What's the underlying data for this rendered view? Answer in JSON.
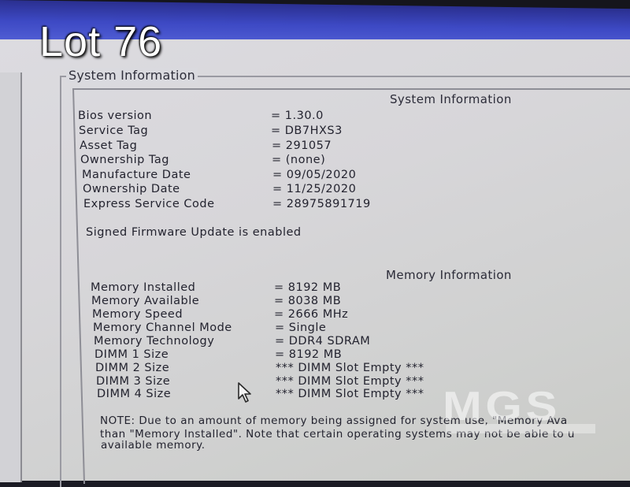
{
  "overlay": {
    "lot_label": "Lot 76",
    "watermark": "MGS"
  },
  "group": {
    "legend": "System Information"
  },
  "system": {
    "title": "System Information",
    "rows": [
      {
        "label": "Bios version",
        "value": "= 1.30.0"
      },
      {
        "label": "Service Tag",
        "value": "= DB7HXS3"
      },
      {
        "label": "Asset Tag",
        "value": "= 291057"
      },
      {
        "label": "Ownership Tag",
        "value": "= (none)"
      },
      {
        "label": "Manufacture Date",
        "value": "= 09/05/2020"
      },
      {
        "label": "Ownership Date",
        "value": "= 11/25/2020"
      },
      {
        "label": "Express Service Code",
        "value": "= 28975891719"
      }
    ],
    "firmware_note": "Signed Firmware Update is enabled"
  },
  "memory": {
    "title": "Memory Information",
    "rows": [
      {
        "label": "Memory Installed",
        "value": "= 8192 MB"
      },
      {
        "label": "Memory Available",
        "value": "= 8038 MB"
      },
      {
        "label": "Memory Speed",
        "value": "= 2666 MHz"
      },
      {
        "label": "Memory Channel Mode",
        "value": "= Single"
      },
      {
        "label": "Memory Technology",
        "value": "= DDR4 SDRAM"
      },
      {
        "label": "DIMM 1 Size",
        "value": "= 8192 MB"
      },
      {
        "label": "DIMM 2 Size",
        "value": "*** DIMM Slot Empty ***"
      },
      {
        "label": "DIMM 3 Size",
        "value": "*** DIMM Slot Empty ***"
      },
      {
        "label": "DIMM 4 Size",
        "value": "*** DIMM Slot Empty ***"
      }
    ],
    "note_lines": [
      "NOTE: Due to an amount of memory being assigned for system use, \"Memory Ava",
      "than \"Memory Installed\". Note that certain operating systems may not be able to u",
      "available memory."
    ]
  },
  "colors": {
    "banner": "#3d49c4",
    "screen": "#d7d6d9",
    "text": "#23232f"
  },
  "icons": {
    "cursor": "mouse-pointer-icon"
  }
}
